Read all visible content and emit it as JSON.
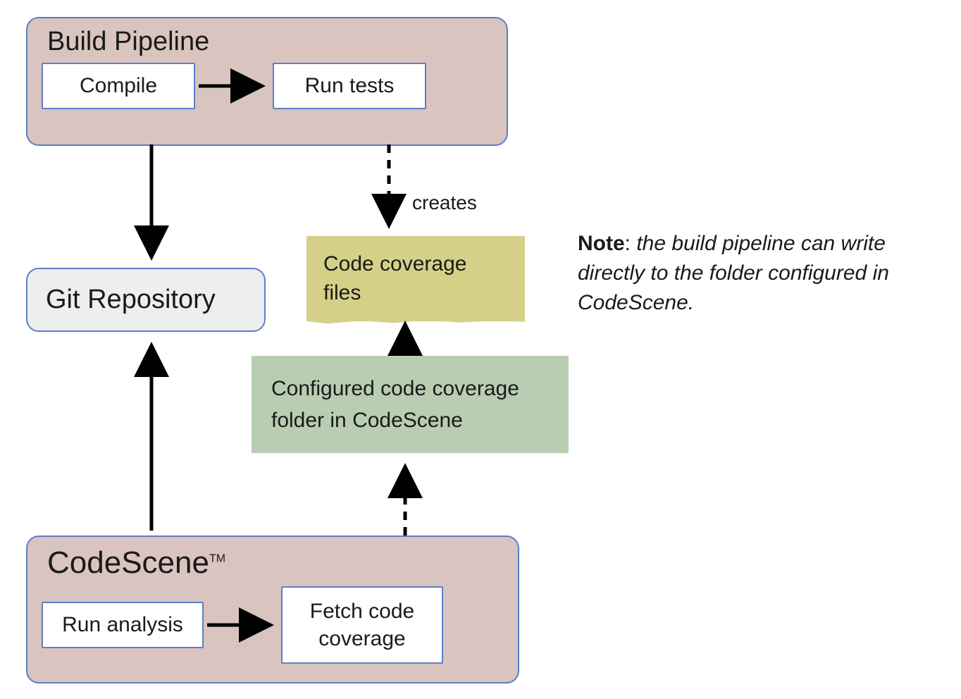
{
  "buildPipeline": {
    "title": "Build Pipeline",
    "compile": "Compile",
    "runTests": "Run tests"
  },
  "gitRepository": "Git Repository",
  "codeCoverageFiles": "Code coverage files",
  "createsLabel": "creates",
  "configuredFolder": "Configured code coverage folder in CodeScene",
  "codeScene": {
    "title": "CodeScene",
    "tm": "TM",
    "runAnalysis": "Run analysis",
    "fetchCoverage": "Fetch code coverage"
  },
  "note": {
    "bold": "Note",
    "colon": ": ",
    "italic": "the build pipeline can write directly to the folder configured in CodeScene."
  }
}
